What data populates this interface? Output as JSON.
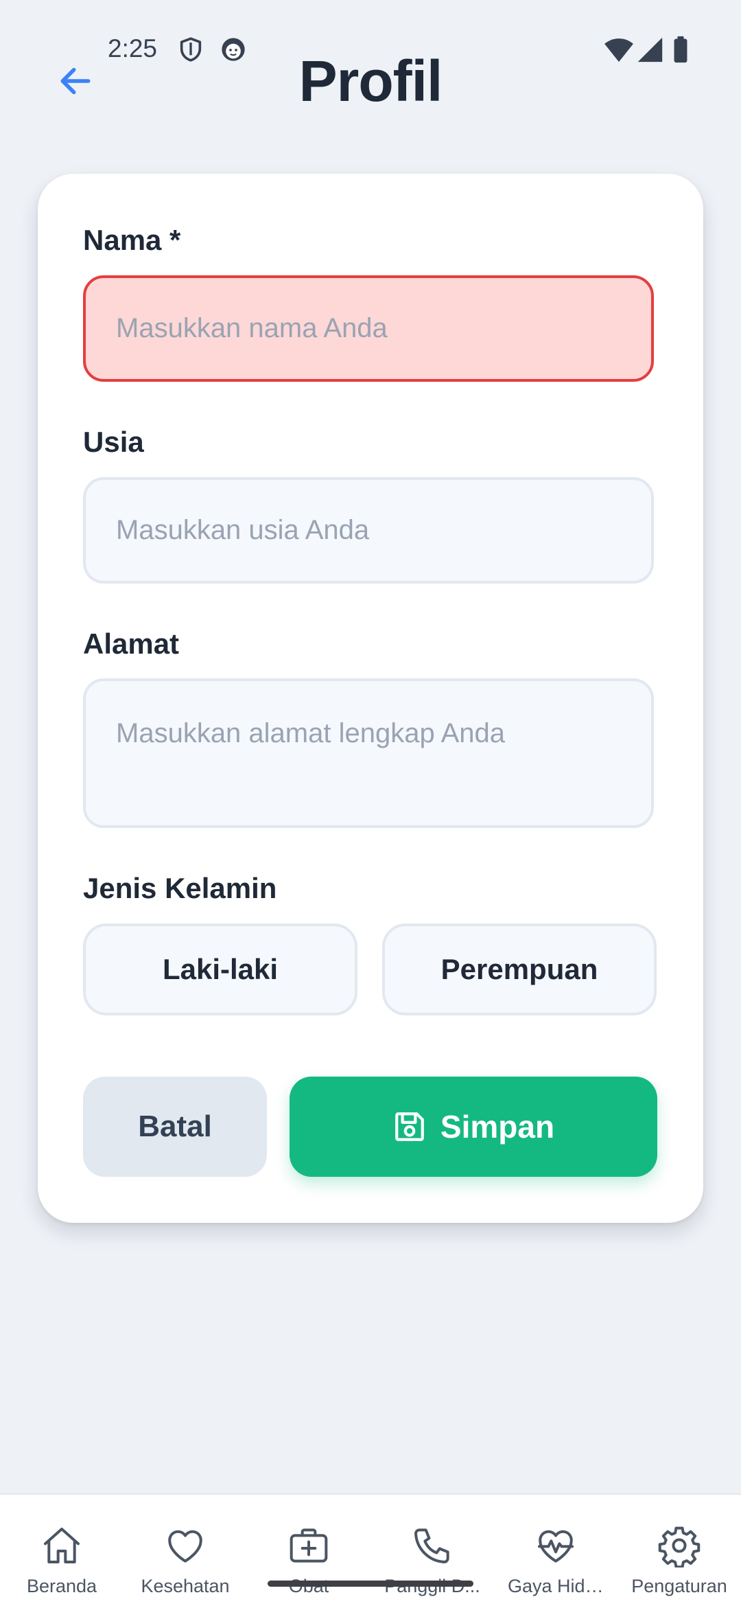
{
  "status_bar": {
    "time": "2:25",
    "icons": [
      "shield-icon",
      "face-icon",
      "wifi-icon",
      "signal-icon",
      "battery-icon"
    ]
  },
  "header": {
    "title": "Profil",
    "back_icon": "arrow-left-icon"
  },
  "form": {
    "name": {
      "label": "Nama *",
      "placeholder": "Masukkan nama Anda",
      "value": "",
      "state": "error"
    },
    "age": {
      "label": "Usia",
      "placeholder": "Masukkan usia Anda",
      "value": ""
    },
    "address": {
      "label": "Alamat",
      "placeholder": "Masukkan alamat lengkap Anda",
      "value": ""
    },
    "gender": {
      "label": "Jenis Kelamin",
      "options": [
        "Laki-laki",
        "Perempuan"
      ]
    },
    "actions": {
      "cancel_label": "Batal",
      "save_label": "Simpan",
      "save_icon": "floppy-disk-icon"
    }
  },
  "bottom_nav": {
    "items": [
      {
        "label": "Beranda",
        "icon": "home-icon"
      },
      {
        "label": "Kesehatan",
        "icon": "heart-icon"
      },
      {
        "label": "Obat",
        "icon": "medical-kit-icon"
      },
      {
        "label": "Panggil D...",
        "icon": "phone-icon"
      },
      {
        "label": "Gaya Hidup",
        "icon": "heart-pulse-icon"
      },
      {
        "label": "Pengaturan",
        "icon": "gear-icon"
      }
    ]
  },
  "colors": {
    "background": "#eef1f6",
    "accent_blue": "#3b82f6",
    "save_green": "#14b981",
    "error_red": "#e53e3e",
    "error_fill": "#fed7d7"
  }
}
